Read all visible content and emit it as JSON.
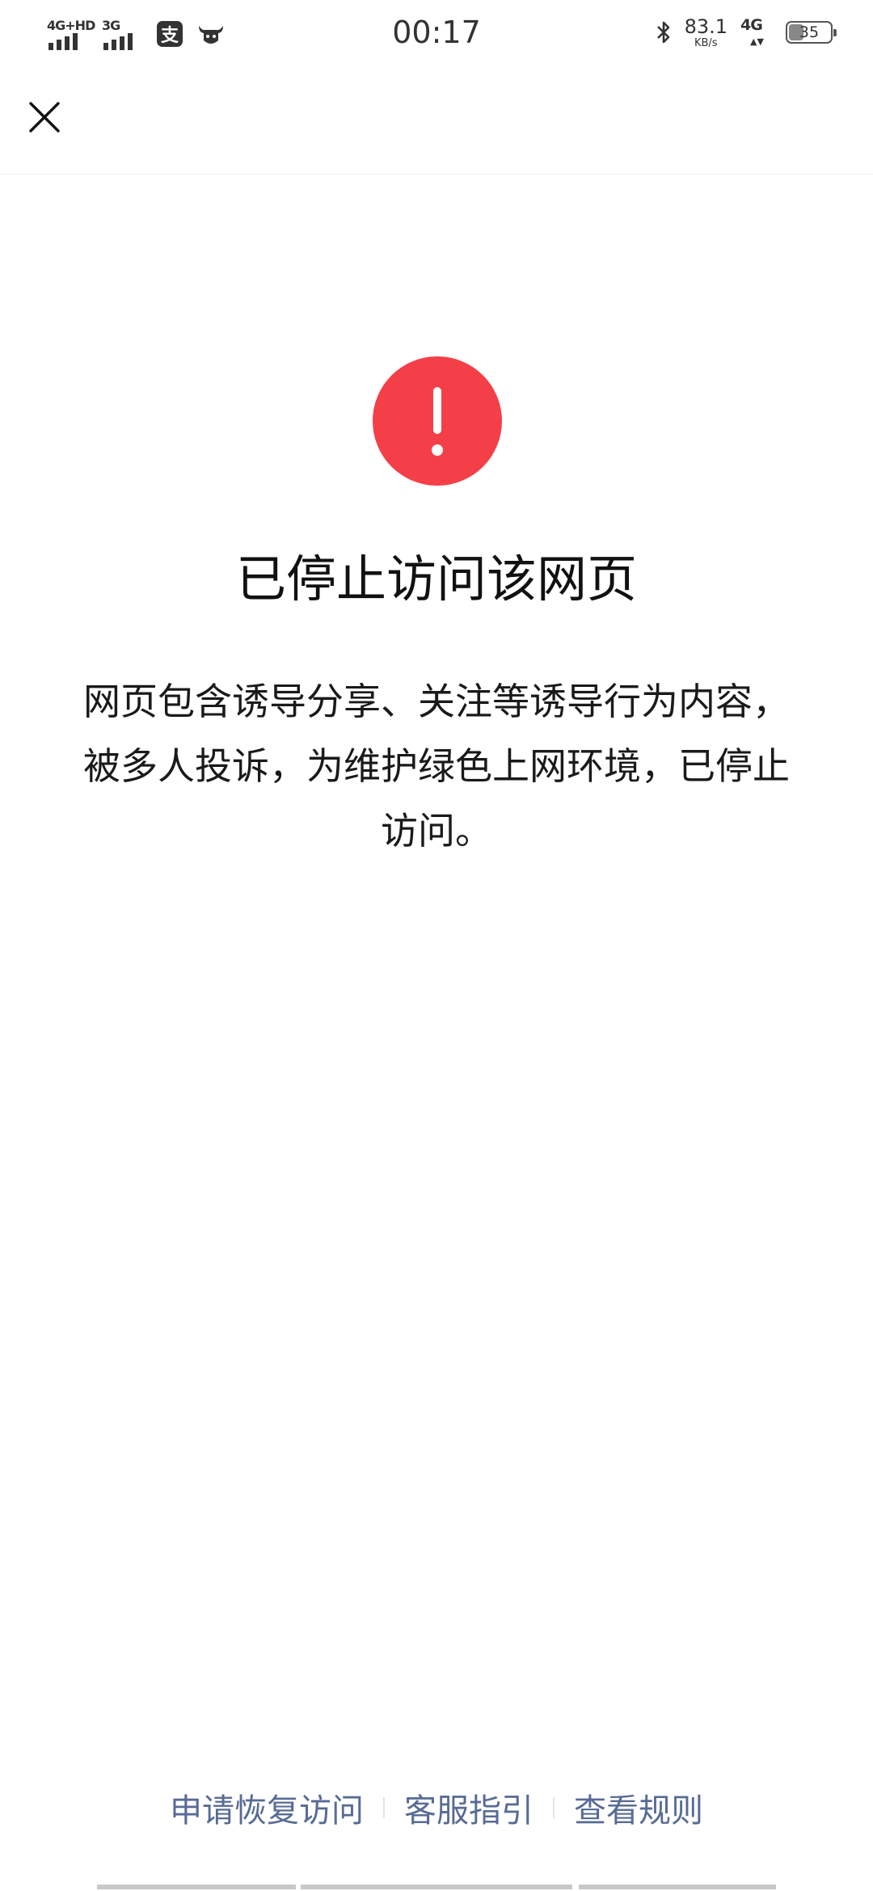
{
  "status_bar": {
    "time": "00:17",
    "sim1_network": "4G+HD",
    "sim2_network": "3G",
    "app_badge_char": "支",
    "speed_value": "83.1",
    "speed_unit": "KB/s",
    "data_network": "4G",
    "battery_level": "35",
    "battery_fraction": 0.35
  },
  "top_bar": {
    "close_icon": "close-icon"
  },
  "main": {
    "alert_icon": "exclamation-circle-icon",
    "alert_color": "#f43f48",
    "title": "已停止访问该网页",
    "description": "网页包含诱导分享、关注等诱导行为内容，被多人投诉，为维护绿色上网环境，已停止访问。"
  },
  "footer": {
    "link_color": "#576b95",
    "links": [
      "申请恢复访问",
      "客服指引",
      "查看规则"
    ]
  }
}
